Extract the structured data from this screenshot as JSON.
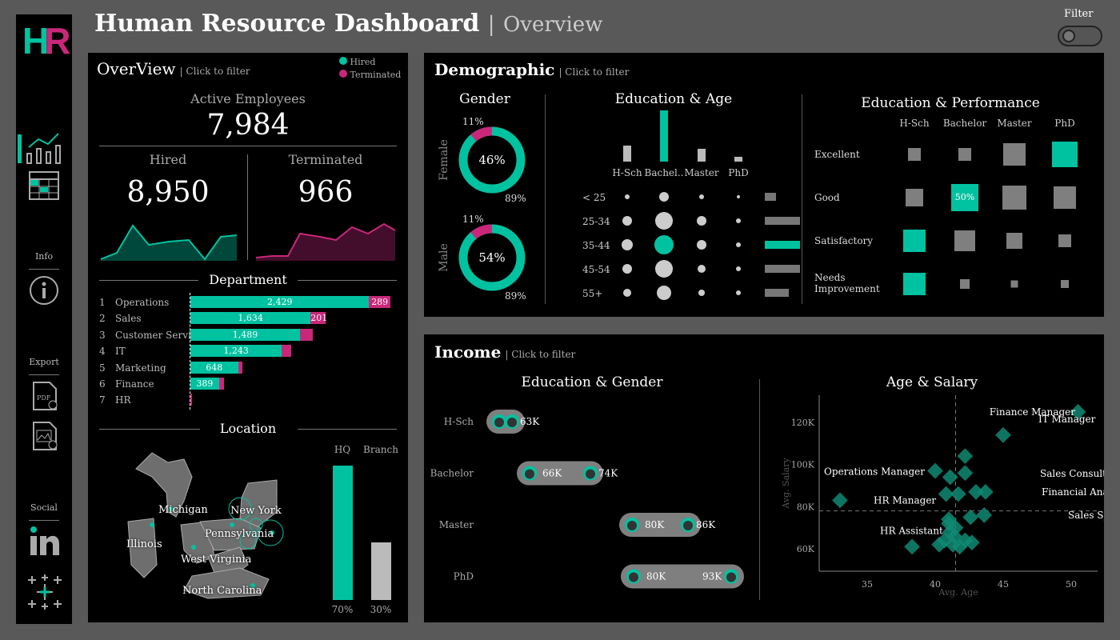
{
  "header": {
    "title": "Human Resource Dashboard",
    "separator": "|",
    "subtitle": "Overview",
    "filter_label": "Filter"
  },
  "sidebar": {
    "logo_h": "H",
    "logo_r": "R",
    "info_label": "Info",
    "export_label": "Export",
    "social_label": "Social"
  },
  "colors": {
    "teal": "#00c2a0",
    "magenta": "#c9287a",
    "grey": "#7f7f7f"
  },
  "overview": {
    "title": "OverView",
    "click": "| Click to filter",
    "legend": [
      {
        "label": "Hired",
        "color": "#00c2a0"
      },
      {
        "label": "Terminated",
        "color": "#c9287a"
      }
    ],
    "active_label": "Active Employees",
    "active_value": "7,984",
    "hired_label": "Hired",
    "hired_value": "8,950",
    "terminated_label": "Terminated",
    "terminated_value": "966",
    "department_title": "Department",
    "departments": [
      {
        "rank": "1",
        "name": "Operations",
        "hired": 2429,
        "hired_label": "2,429",
        "terminated": 289,
        "term_label": "289"
      },
      {
        "rank": "2",
        "name": "Sales",
        "hired": 1634,
        "hired_label": "1,634",
        "terminated": 201,
        "term_label": "201"
      },
      {
        "rank": "3",
        "name": "Customer Service",
        "hired": 1489,
        "hired_label": "1,489",
        "terminated": 170,
        "term_label": ""
      },
      {
        "rank": "4",
        "name": "IT",
        "hired": 1243,
        "hired_label": "1,243",
        "terminated": 130,
        "term_label": ""
      },
      {
        "rank": "5",
        "name": "Marketing",
        "hired": 648,
        "hired_label": "648",
        "terminated": 60,
        "term_label": ""
      },
      {
        "rank": "6",
        "name": "Finance",
        "hired": 389,
        "hired_label": "389",
        "terminated": 70,
        "term_label": ""
      },
      {
        "rank": "7",
        "name": "HR",
        "hired": 0,
        "hired_label": "",
        "terminated": 18,
        "term_label": ""
      }
    ],
    "location_title": "Location",
    "states": [
      "Michigan",
      "New York",
      "Illinois",
      "Pennsylvania",
      "West Virginia",
      "North Carolina"
    ],
    "location_bars": [
      {
        "label": "HQ",
        "pct": 70,
        "pct_label": "70%"
      },
      {
        "label": "Branch",
        "pct": 30,
        "pct_label": "30%"
      }
    ]
  },
  "demographic": {
    "title": "Demographic",
    "click": "| Click to filter",
    "gender_title": "Gender",
    "genders": [
      {
        "label": "Female",
        "pct": 46,
        "pct_label": "46%",
        "minor_label": "11%",
        "major_label": "89%"
      },
      {
        "label": "Male",
        "pct": 54,
        "pct_label": "54%",
        "minor_label": "11%",
        "major_label": "89%"
      }
    ],
    "edu_age_title": "Education & Age",
    "edu_levels": [
      "H-Sch",
      "Bachel..",
      "Master",
      "PhD"
    ],
    "age_groups": [
      "< 25",
      "25-34",
      "35-44",
      "45-54",
      "55+"
    ],
    "edu_perf_title": "Education & Performance",
    "perf_cols": [
      "H-Sch",
      "Bachelor",
      "Master",
      "PhD"
    ],
    "perf_rows": [
      "Excellent",
      "Good",
      "Satisfactory",
      "Needs Improvement"
    ],
    "perf_highlight_label": "50%"
  },
  "income": {
    "title": "Income",
    "click": "| Click to filter",
    "edu_gender_title": "Education & Gender",
    "rows": [
      {
        "label": "H-Sch",
        "female": "",
        "male": "63K"
      },
      {
        "label": "Bachelor",
        "female": "66K",
        "male": "74K"
      },
      {
        "label": "Master",
        "female": "80K",
        "male": "86K"
      },
      {
        "label": "PhD",
        "female": "80K",
        "male": "93K"
      }
    ],
    "age_salary_title": "Age & Salary",
    "y_ticks": [
      "120K",
      "100K",
      "80K",
      "60K"
    ],
    "x_ticks": [
      "35",
      "40",
      "45",
      "50"
    ],
    "ylabel": "Avg. Salary",
    "xlabel": "Avg. Age",
    "annotations": [
      "Finance Manager",
      "IT Manager",
      "Operations Manager",
      "Sales Consultant",
      "Financial Analyst",
      "HR Manager",
      "Sales Specialist",
      "HR Assistant"
    ]
  }
}
